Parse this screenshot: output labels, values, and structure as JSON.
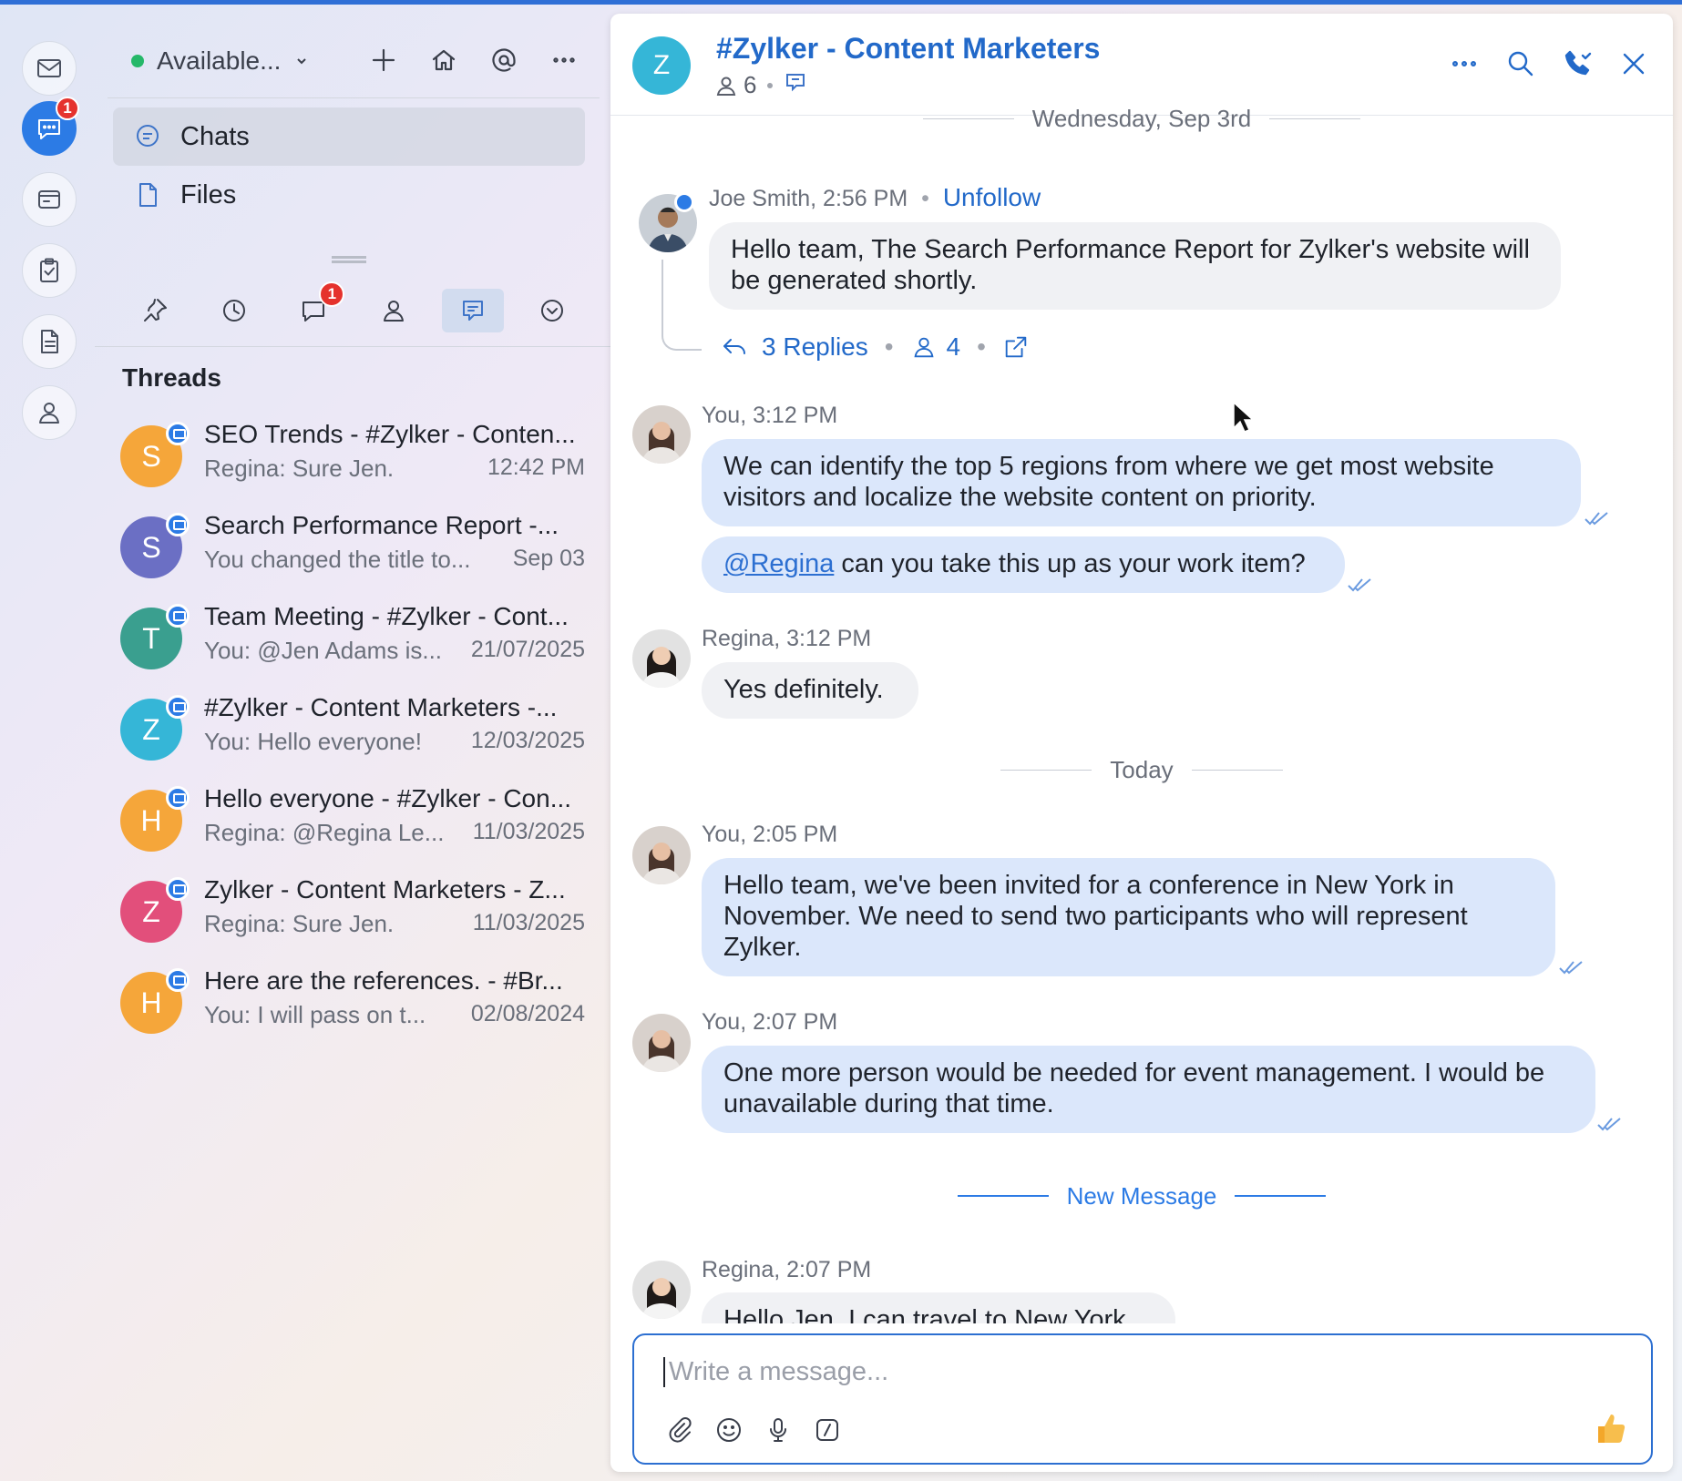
{
  "rail": {
    "chat_badge": "1"
  },
  "panel": {
    "status": "Available...",
    "nav": [
      {
        "label": "Chats"
      },
      {
        "label": "Files"
      }
    ],
    "chats_tab_badge": "1",
    "threads_heading": "Threads",
    "threads": [
      {
        "initial": "S",
        "color": "#f5a63a",
        "title": "SEO Trends - #Zylker - Conten...",
        "preview": "Regina: Sure Jen.",
        "time": "12:42 PM"
      },
      {
        "initial": "S",
        "color": "#6b6fc4",
        "title": "Search Performance Report -...",
        "preview": "You changed the title to...",
        "time": "Sep 03"
      },
      {
        "initial": "T",
        "color": "#3a9f8f",
        "title": "Team Meeting - #Zylker - Cont...",
        "preview": "You: @Jen Adams  is...",
        "time": "21/07/2025"
      },
      {
        "initial": "Z",
        "color": "#35b6d7",
        "title": "#Zylker - Content Marketers -...",
        "preview": "You: Hello everyone!",
        "time": "12/03/2025"
      },
      {
        "initial": "H",
        "color": "#f5a63a",
        "title": "Hello everyone - #Zylker - Con...",
        "preview": "Regina: @Regina Le...",
        "time": "11/03/2025"
      },
      {
        "initial": "Z",
        "color": "#e24f7b",
        "title": "Zylker - Content Marketers - Z...",
        "preview": "Regina: Sure Jen.",
        "time": "11/03/2025"
      },
      {
        "initial": "H",
        "color": "#f5a63a",
        "title": "Here are the references. - #Br...",
        "preview": "You: I will pass on t...",
        "time": "02/08/2024"
      }
    ]
  },
  "chat": {
    "avatar_initial": "Z",
    "title": "#Zylker - Content Marketers",
    "member_count": "6",
    "date_sep_1": "Wednesday, Sep 3rd",
    "joe_meta": "Joe Smith, 2:56 PM",
    "unfollow": "Unfollow",
    "joe_msg": "Hello team, The Search Performance Report for Zylker's website will be generated shortly.",
    "replies": "3 Replies",
    "participants": "4",
    "you_meta_1": "You, 3:12 PM",
    "you_msg_1": "We can identify the top 5 regions from where we get most website visitors and localize the website content on priority.",
    "mention": "@Regina",
    "you_msg_2_rest": " can you take this up as your work item?",
    "regina_meta_1": "Regina, 3:12 PM",
    "regina_msg_1": "Yes definitely.",
    "date_sep_2": "Today",
    "you_meta_2": "You, 2:05 PM",
    "you_msg_3": "Hello team, we've been invited for a conference in New York in November. We need to send two participants who will represent Zylker.",
    "you_meta_3": "You, 2:07 PM",
    "you_msg_4": "One more person would be needed for event management. I would be unavailable during that time.",
    "new_message": "New Message",
    "regina_meta_2": "Regina, 2:07 PM",
    "regina_msg_2": "Hello Jen, I can travel to New York",
    "composer_placeholder": "Write a message..."
  }
}
